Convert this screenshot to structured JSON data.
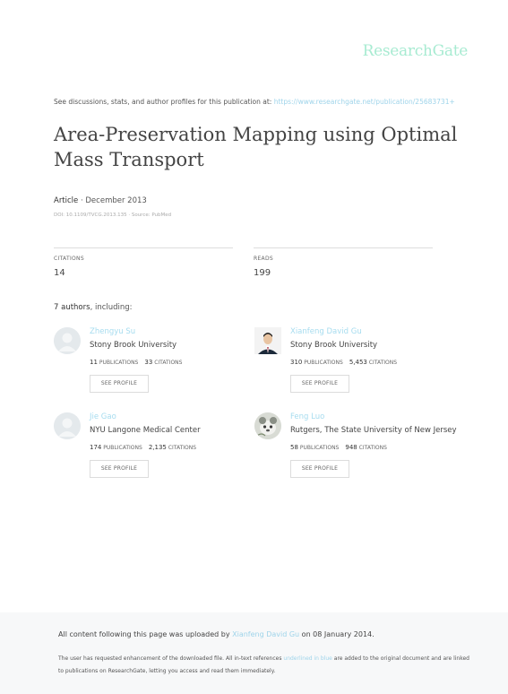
{
  "brand": "ResearchGate",
  "discussion": {
    "text": "See discussions, stats, and author profiles for this publication at: ",
    "url": "https://www.researchgate.net/publication/25683731+"
  },
  "article": {
    "title": "Area-Preservation Mapping using Optimal Mass Transport",
    "type": "Article",
    "date_sep": " · ",
    "date": "December 2013",
    "doi_source": "DOI: 10.1109/TVCG.2013.135 · Source: PubMed"
  },
  "stats": {
    "citations_label": "CITATIONS",
    "citations": "14",
    "reads_label": "READS",
    "reads": "199"
  },
  "authors_heading": {
    "count": "7 authors",
    "suffix": ", including:"
  },
  "labels": {
    "publications": "PUBLICATIONS",
    "citations": "CITATIONS",
    "see_profile": "SEE PROFILE"
  },
  "authors": [
    {
      "name": "Zhengyu Su",
      "institution": "Stony Brook University",
      "publications": "11",
      "citations": "33",
      "avatar": "placeholder-avatar-icon"
    },
    {
      "name": "Xianfeng David Gu",
      "institution": "Stony Brook University",
      "publications": "310",
      "citations": "5,453",
      "avatar": "portrait-photo"
    },
    {
      "name": "Jie Gao",
      "institution": "NYU Langone Medical Center",
      "publications": "174",
      "citations": "2,135",
      "avatar": "placeholder-avatar-icon"
    },
    {
      "name": "Feng Luo",
      "institution": "Rutgers, The State University of New Jersey",
      "publications": "58",
      "citations": "948",
      "avatar": "photo"
    }
  ],
  "footer": {
    "uploaded_prefix": "All content following this page was uploaded by ",
    "uploader": "Xianfeng David Gu",
    "uploaded_suffix": " on 08 January 2014.",
    "note_prefix": "The user has requested enhancement of the downloaded file. All in-text references ",
    "note_link": "underlined in blue",
    "note_suffix": " are added to the original document and are linked to publications on ResearchGate, letting you access and read them immediately."
  },
  "colors": {
    "brand": "#a8ebd2",
    "link": "#9fd4ea"
  }
}
